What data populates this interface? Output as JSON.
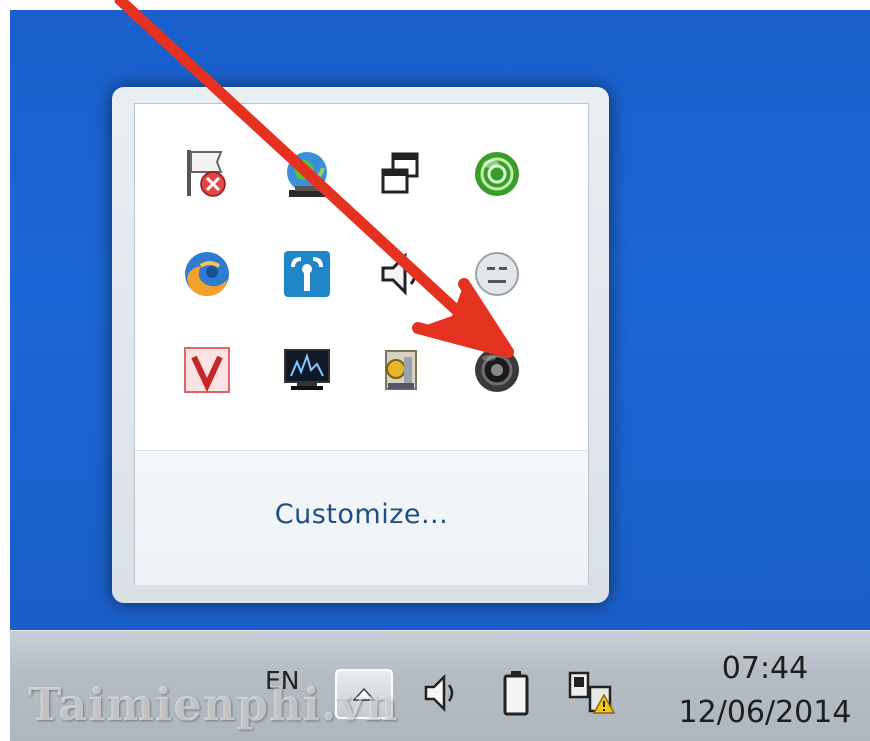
{
  "flyout": {
    "customize_label": "Customize...",
    "icons": [
      [
        "flag-error-icon",
        "globe-network-icon",
        "windows-overlap-icon",
        "green-sphere-icon"
      ],
      [
        "firefox-like-icon",
        "wifi-manager-icon",
        "speaker-icon",
        "smiley-icon"
      ],
      [
        "v-app-icon",
        "monitor-network-icon",
        "scanner-app-icon",
        "dark-speaker-icon"
      ]
    ]
  },
  "taskbar": {
    "language": "EN",
    "time": "07:44",
    "date": "12/06/2014"
  },
  "watermark": "Taimienphi.vn",
  "colors": {
    "desktop": "#1b66d6",
    "arrow": "#e5311f",
    "link": "#1f4f82"
  }
}
